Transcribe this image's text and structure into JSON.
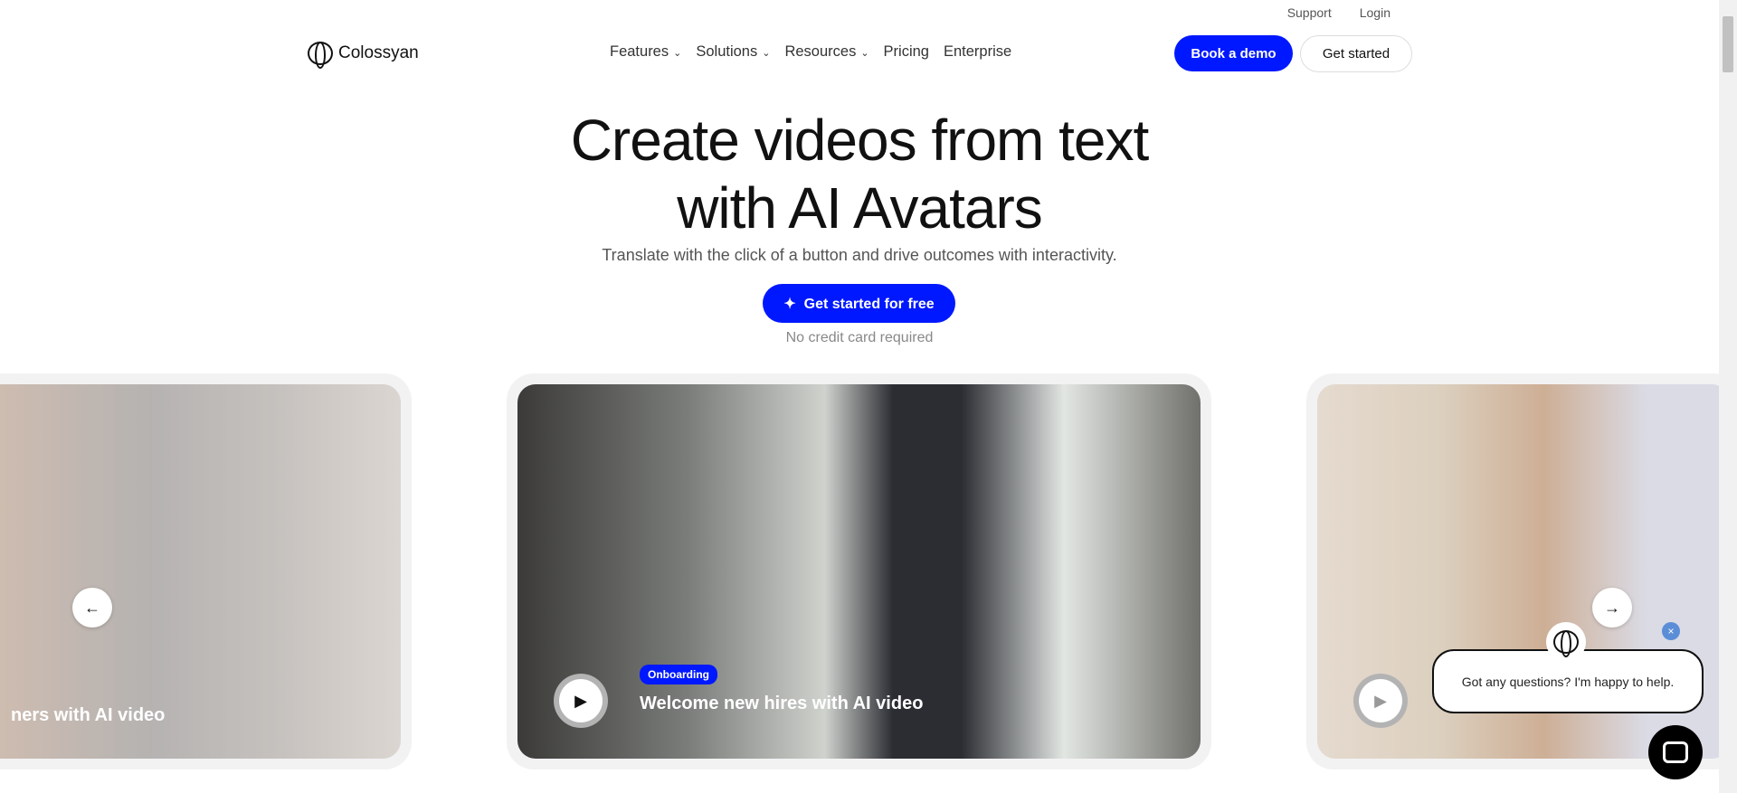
{
  "header": {
    "top_links": [
      "Support",
      "Login"
    ],
    "brand": "Colossyan",
    "nav": [
      {
        "label": "Features",
        "dropdown": true
      },
      {
        "label": "Solutions",
        "dropdown": true
      },
      {
        "label": "Resources",
        "dropdown": true
      },
      {
        "label": "Pricing",
        "dropdown": false
      },
      {
        "label": "Enterprise",
        "dropdown": false
      }
    ],
    "book_demo": "Book a demo",
    "get_started": "Get started"
  },
  "hero": {
    "title_line1": "Create videos from text",
    "title_line2": "with AI Avatars",
    "subtitle": "Translate with the click of a button and drive outcomes with interactivity.",
    "cta": "Get started for free",
    "note": "No credit card required"
  },
  "carousel": {
    "cards": [
      {
        "title": "ners with AI video"
      },
      {
        "tag": "Onboarding",
        "title": "Welcome new hires with AI video"
      },
      {
        "title": ""
      }
    ]
  },
  "chat": {
    "message": "Got any questions? I'm happy to help.",
    "close": "×"
  },
  "colors": {
    "accent": "#0018ff"
  }
}
